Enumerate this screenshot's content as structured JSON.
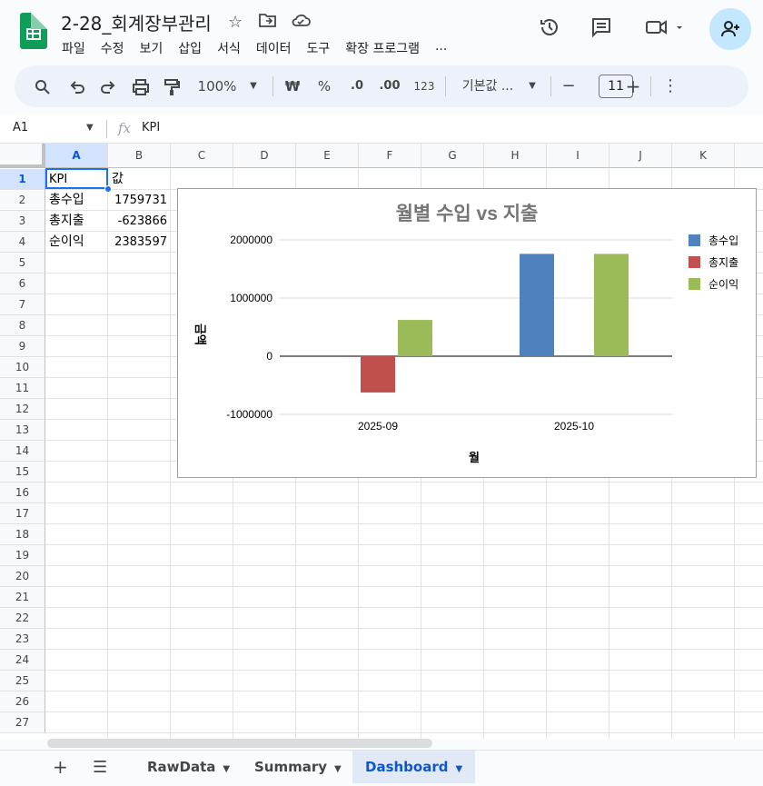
{
  "doc": {
    "title": "2-28_회계장부관리"
  },
  "menu": [
    "파일",
    "수정",
    "보기",
    "삽입",
    "서식",
    "데이터",
    "도구",
    "확장 프로그램",
    "..."
  ],
  "toolbar": {
    "zoom": "100%",
    "currency": "₩",
    "percent": "%",
    "dec_less": ".0",
    "dec_more": ".00",
    "num_fmt": "123",
    "font": "기본값 ...",
    "font_size": "11",
    "minus": "−",
    "plus": "+"
  },
  "formula": {
    "cell_ref": "A1",
    "fx": "fx",
    "value": "KPI"
  },
  "columns": [
    "A",
    "B",
    "C",
    "D",
    "E",
    "F",
    "G",
    "H",
    "I",
    "J",
    "K"
  ],
  "rows": [
    "1",
    "2",
    "3",
    "4",
    "5",
    "6",
    "7",
    "8",
    "9",
    "10",
    "11",
    "12",
    "13",
    "14",
    "15",
    "16",
    "17",
    "18",
    "19",
    "20",
    "21",
    "22",
    "23",
    "24",
    "25",
    "26",
    "27"
  ],
  "cells": [
    {
      "a": "KPI",
      "b": "값"
    },
    {
      "a": "총수입",
      "b": "1759731"
    },
    {
      "a": "총지출",
      "b": "-623866"
    },
    {
      "a": "순이익",
      "b": "2383597"
    }
  ],
  "chart_data": {
    "type": "bar",
    "title": "월별 수입 vs 지출",
    "xlabel": "월",
    "ylabel": "금액",
    "categories": [
      "2025-09",
      "2025-10"
    ],
    "series": [
      {
        "name": "총수입",
        "color": "#4e81bd",
        "values": [
          0,
          1759731
        ]
      },
      {
        "name": "총지출",
        "color": "#c0504d",
        "values": [
          -623866,
          0
        ]
      },
      {
        "name": "순이익",
        "color": "#9bbb59",
        "values": [
          623866,
          1759731
        ]
      }
    ],
    "yticks": [
      "2000000",
      "1000000",
      "0",
      "-1000000"
    ],
    "ylim": [
      -1000000,
      2000000
    ],
    "legend": "right"
  },
  "sheets": [
    {
      "name": "RawData",
      "active": false
    },
    {
      "name": "Summary",
      "active": false
    },
    {
      "name": "Dashboard",
      "active": true
    }
  ],
  "colors": {
    "accent": "#0b57d0",
    "select": "#1a73e8",
    "header_sel": "#d3e3fd"
  }
}
